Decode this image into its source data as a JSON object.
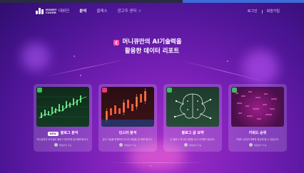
{
  "nav": {
    "logo_line1": "MONEY",
    "logo_line2": "CUSOR",
    "menu": [
      {
        "label": "데뷔단",
        "active": false
      },
      {
        "label": "분석",
        "active": true
      },
      {
        "label": "클래스",
        "active": false
      },
      {
        "label": "광고주 센터 ☆",
        "active": false
      }
    ],
    "login": "로그인",
    "signup": "회원가입"
  },
  "hero": {
    "line1": "머니큐만의 AI기술력을",
    "line2": "활용한 데이터 리포트"
  },
  "cards": [
    {
      "badge_color": "#3bbf5a",
      "pill": "NEW",
      "title": "블로그 분석",
      "desc": "머니큐만의 AI기술로 블로그 데이터를 분석해드립니다.",
      "meta": "일일분석 가능",
      "thumb": "stock-chart"
    },
    {
      "badge_color": "#e8357d",
      "pill": "",
      "title": "인스타 분석",
      "desc": "분석 기술을 활용하여 인스타 계정을 분석해드립니다.",
      "meta": "일일분석 가능",
      "thumb": "candle-chart"
    },
    {
      "badge_color": "#3bbf5a",
      "pill": "",
      "title": "블로그 글 요약",
      "desc": "긴 블로그 포스팅 내용을 AI가 요약해 드립니다.",
      "meta": "일일분석 가능",
      "thumb": "ai-brain"
    },
    {
      "badge_color": "#3bbf5a",
      "pill": "",
      "title": "키워드 순위",
      "desc": "키워드 순위의 변화를 한눈에 볼 수 있습니다.",
      "meta": "일일분석 가능",
      "thumb": "keyword-grid"
    }
  ]
}
